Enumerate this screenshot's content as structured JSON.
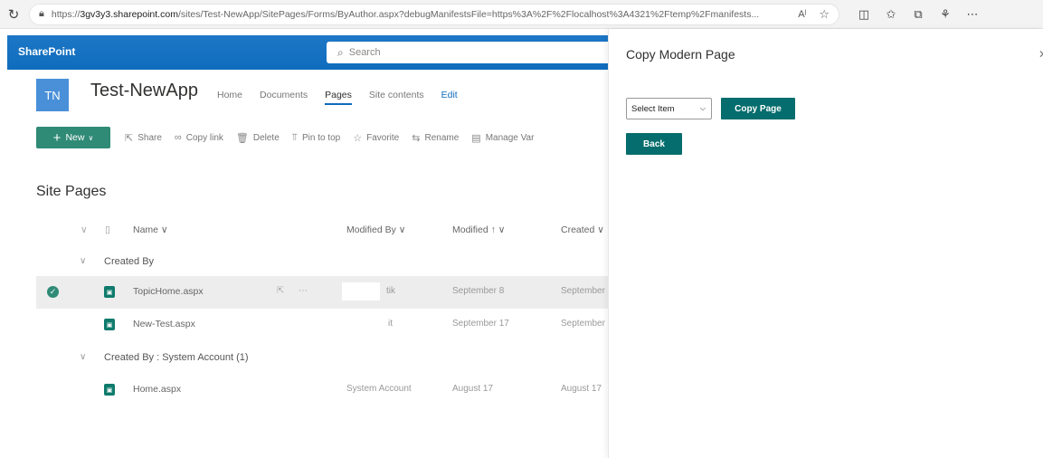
{
  "browser": {
    "url_prefix": "https://",
    "url_host": "3gv3y3.sharepoint.com",
    "url_rest": "/sites/Test-NewApp/SitePages/Forms/ByAuthor.aspx?debugManifestsFile=https%3A%2F%2Flocalhost%3A4321%2Ftemp%2Fmanifests..."
  },
  "suite": {
    "title": "SharePoint",
    "search_placeholder": "Search"
  },
  "site": {
    "logo": "TN",
    "name": "Test-NewApp",
    "nav": [
      "Home",
      "Documents",
      "Pages",
      "Site contents",
      "Edit"
    ]
  },
  "commands": {
    "new": "New",
    "items": [
      "Share",
      "Copy link",
      "Delete",
      "Pin to top",
      "Favorite",
      "Rename",
      "Manage Var"
    ]
  },
  "list": {
    "title": "Site Pages",
    "columns": {
      "name": "Name",
      "modified_by": "Modified By",
      "modified": "Modified",
      "created": "Created"
    },
    "groups": [
      {
        "label": "Created By",
        "rows": [
          {
            "name": "TopicHome.aspx",
            "modified_by": "tik",
            "modified": "September 8",
            "created": "September"
          },
          {
            "name": "New-Test.aspx",
            "modified_by": "it",
            "modified": "September 17",
            "created": "September"
          }
        ]
      },
      {
        "label": "Created By : System Account (1)",
        "rows": [
          {
            "name": "Home.aspx",
            "modified_by": "System Account",
            "modified": "August 17",
            "created": "August 17"
          }
        ]
      }
    ]
  },
  "panel": {
    "title": "Copy Modern Page",
    "select_label": "Select Item",
    "copy_button": "Copy Page",
    "back_button": "Back"
  }
}
